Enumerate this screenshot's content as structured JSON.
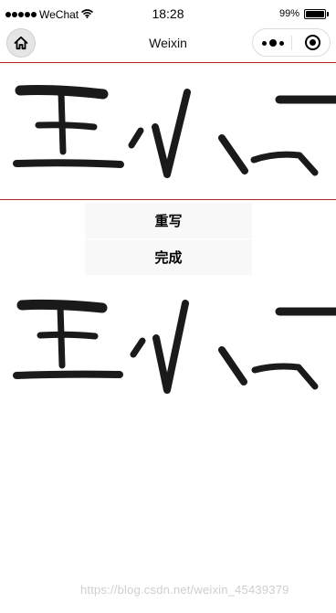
{
  "status_bar": {
    "carrier": "WeChat",
    "time": "18:28",
    "battery_percent": "99%",
    "battery_level": 0.99,
    "signal_icon": "signal-dots-icon",
    "wifi_icon": "wifi-icon",
    "battery_icon": "battery-icon"
  },
  "nav": {
    "title": "Weixin",
    "home_icon": "home-icon",
    "menu_icon": "more-icon",
    "close_icon": "target-icon"
  },
  "buttons": {
    "rewrite": "重写",
    "done": "完成"
  },
  "colors": {
    "canvas_border": "#b22222",
    "stroke": "#1a1a1a",
    "button_bg": "#f8f8f8"
  },
  "watermark": "https://blog.csdn.net/weixin_45439379"
}
